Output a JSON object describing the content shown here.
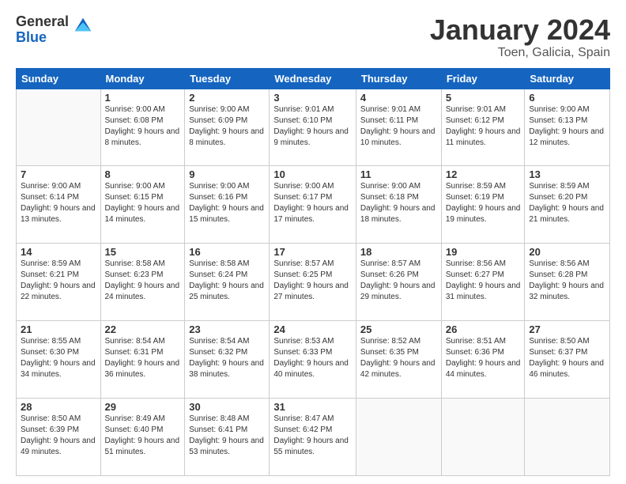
{
  "logo": {
    "general": "General",
    "blue": "Blue"
  },
  "header": {
    "month": "January 2024",
    "location": "Toen, Galicia, Spain"
  },
  "weekdays": [
    "Sunday",
    "Monday",
    "Tuesday",
    "Wednesday",
    "Thursday",
    "Friday",
    "Saturday"
  ],
  "weeks": [
    [
      {
        "day": "",
        "sunrise": "",
        "sunset": "",
        "daylight": ""
      },
      {
        "day": "1",
        "sunrise": "Sunrise: 9:00 AM",
        "sunset": "Sunset: 6:08 PM",
        "daylight": "Daylight: 9 hours and 8 minutes."
      },
      {
        "day": "2",
        "sunrise": "Sunrise: 9:00 AM",
        "sunset": "Sunset: 6:09 PM",
        "daylight": "Daylight: 9 hours and 8 minutes."
      },
      {
        "day": "3",
        "sunrise": "Sunrise: 9:01 AM",
        "sunset": "Sunset: 6:10 PM",
        "daylight": "Daylight: 9 hours and 9 minutes."
      },
      {
        "day": "4",
        "sunrise": "Sunrise: 9:01 AM",
        "sunset": "Sunset: 6:11 PM",
        "daylight": "Daylight: 9 hours and 10 minutes."
      },
      {
        "day": "5",
        "sunrise": "Sunrise: 9:01 AM",
        "sunset": "Sunset: 6:12 PM",
        "daylight": "Daylight: 9 hours and 11 minutes."
      },
      {
        "day": "6",
        "sunrise": "Sunrise: 9:00 AM",
        "sunset": "Sunset: 6:13 PM",
        "daylight": "Daylight: 9 hours and 12 minutes."
      }
    ],
    [
      {
        "day": "7",
        "sunrise": "Sunrise: 9:00 AM",
        "sunset": "Sunset: 6:14 PM",
        "daylight": "Daylight: 9 hours and 13 minutes."
      },
      {
        "day": "8",
        "sunrise": "Sunrise: 9:00 AM",
        "sunset": "Sunset: 6:15 PM",
        "daylight": "Daylight: 9 hours and 14 minutes."
      },
      {
        "day": "9",
        "sunrise": "Sunrise: 9:00 AM",
        "sunset": "Sunset: 6:16 PM",
        "daylight": "Daylight: 9 hours and 15 minutes."
      },
      {
        "day": "10",
        "sunrise": "Sunrise: 9:00 AM",
        "sunset": "Sunset: 6:17 PM",
        "daylight": "Daylight: 9 hours and 17 minutes."
      },
      {
        "day": "11",
        "sunrise": "Sunrise: 9:00 AM",
        "sunset": "Sunset: 6:18 PM",
        "daylight": "Daylight: 9 hours and 18 minutes."
      },
      {
        "day": "12",
        "sunrise": "Sunrise: 8:59 AM",
        "sunset": "Sunset: 6:19 PM",
        "daylight": "Daylight: 9 hours and 19 minutes."
      },
      {
        "day": "13",
        "sunrise": "Sunrise: 8:59 AM",
        "sunset": "Sunset: 6:20 PM",
        "daylight": "Daylight: 9 hours and 21 minutes."
      }
    ],
    [
      {
        "day": "14",
        "sunrise": "Sunrise: 8:59 AM",
        "sunset": "Sunset: 6:21 PM",
        "daylight": "Daylight: 9 hours and 22 minutes."
      },
      {
        "day": "15",
        "sunrise": "Sunrise: 8:58 AM",
        "sunset": "Sunset: 6:23 PM",
        "daylight": "Daylight: 9 hours and 24 minutes."
      },
      {
        "day": "16",
        "sunrise": "Sunrise: 8:58 AM",
        "sunset": "Sunset: 6:24 PM",
        "daylight": "Daylight: 9 hours and 25 minutes."
      },
      {
        "day": "17",
        "sunrise": "Sunrise: 8:57 AM",
        "sunset": "Sunset: 6:25 PM",
        "daylight": "Daylight: 9 hours and 27 minutes."
      },
      {
        "day": "18",
        "sunrise": "Sunrise: 8:57 AM",
        "sunset": "Sunset: 6:26 PM",
        "daylight": "Daylight: 9 hours and 29 minutes."
      },
      {
        "day": "19",
        "sunrise": "Sunrise: 8:56 AM",
        "sunset": "Sunset: 6:27 PM",
        "daylight": "Daylight: 9 hours and 31 minutes."
      },
      {
        "day": "20",
        "sunrise": "Sunrise: 8:56 AM",
        "sunset": "Sunset: 6:28 PM",
        "daylight": "Daylight: 9 hours and 32 minutes."
      }
    ],
    [
      {
        "day": "21",
        "sunrise": "Sunrise: 8:55 AM",
        "sunset": "Sunset: 6:30 PM",
        "daylight": "Daylight: 9 hours and 34 minutes."
      },
      {
        "day": "22",
        "sunrise": "Sunrise: 8:54 AM",
        "sunset": "Sunset: 6:31 PM",
        "daylight": "Daylight: 9 hours and 36 minutes."
      },
      {
        "day": "23",
        "sunrise": "Sunrise: 8:54 AM",
        "sunset": "Sunset: 6:32 PM",
        "daylight": "Daylight: 9 hours and 38 minutes."
      },
      {
        "day": "24",
        "sunrise": "Sunrise: 8:53 AM",
        "sunset": "Sunset: 6:33 PM",
        "daylight": "Daylight: 9 hours and 40 minutes."
      },
      {
        "day": "25",
        "sunrise": "Sunrise: 8:52 AM",
        "sunset": "Sunset: 6:35 PM",
        "daylight": "Daylight: 9 hours and 42 minutes."
      },
      {
        "day": "26",
        "sunrise": "Sunrise: 8:51 AM",
        "sunset": "Sunset: 6:36 PM",
        "daylight": "Daylight: 9 hours and 44 minutes."
      },
      {
        "day": "27",
        "sunrise": "Sunrise: 8:50 AM",
        "sunset": "Sunset: 6:37 PM",
        "daylight": "Daylight: 9 hours and 46 minutes."
      }
    ],
    [
      {
        "day": "28",
        "sunrise": "Sunrise: 8:50 AM",
        "sunset": "Sunset: 6:39 PM",
        "daylight": "Daylight: 9 hours and 49 minutes."
      },
      {
        "day": "29",
        "sunrise": "Sunrise: 8:49 AM",
        "sunset": "Sunset: 6:40 PM",
        "daylight": "Daylight: 9 hours and 51 minutes."
      },
      {
        "day": "30",
        "sunrise": "Sunrise: 8:48 AM",
        "sunset": "Sunset: 6:41 PM",
        "daylight": "Daylight: 9 hours and 53 minutes."
      },
      {
        "day": "31",
        "sunrise": "Sunrise: 8:47 AM",
        "sunset": "Sunset: 6:42 PM",
        "daylight": "Daylight: 9 hours and 55 minutes."
      },
      {
        "day": "",
        "sunrise": "",
        "sunset": "",
        "daylight": ""
      },
      {
        "day": "",
        "sunrise": "",
        "sunset": "",
        "daylight": ""
      },
      {
        "day": "",
        "sunrise": "",
        "sunset": "",
        "daylight": ""
      }
    ]
  ]
}
